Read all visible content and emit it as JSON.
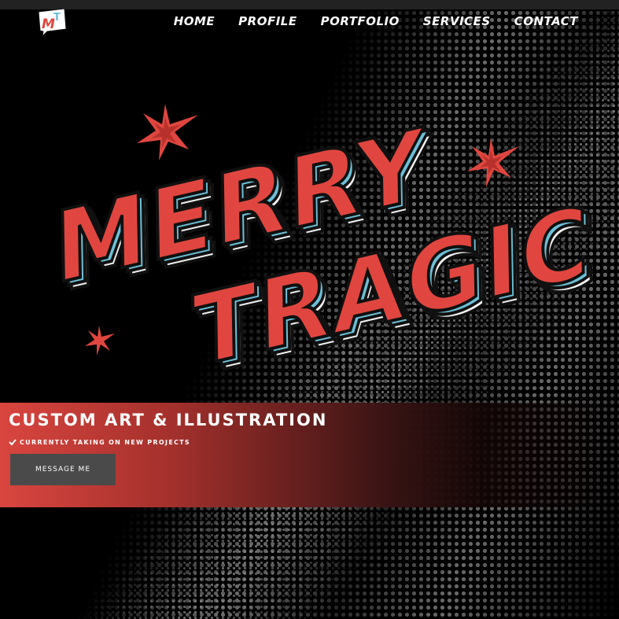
{
  "logo": {
    "text": "MT",
    "colors": {
      "m": "#e0463f",
      "t": "#6cbfd6"
    }
  },
  "nav": {
    "items": [
      {
        "label": "HOME"
      },
      {
        "label": "PROFILE"
      },
      {
        "label": "PORTFOLIO"
      },
      {
        "label": "SERVICES"
      },
      {
        "label": "CONTACT"
      }
    ]
  },
  "hero": {
    "title_line1": "MERRY",
    "title_line2": "TRAGIC",
    "colors": {
      "face": "#e0463f",
      "side": "#6cbfd6",
      "bottom": "#f2f2f2",
      "outline": "#101010"
    }
  },
  "band": {
    "title": "CUSTOM ART & ILLUSTRATION",
    "subtitle": "CURRENTLY TAKING ON NEW PROJECTS",
    "cta_label": "MESSAGE ME",
    "colors": {
      "start": "#d9453f",
      "end": "#000000"
    }
  }
}
